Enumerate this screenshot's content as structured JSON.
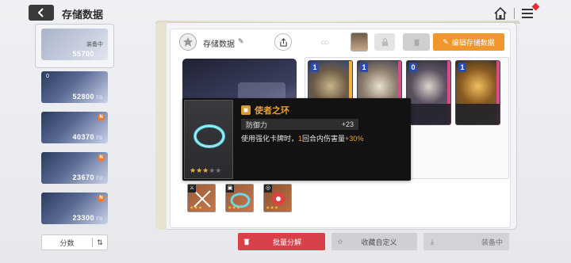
{
  "header": {
    "title": "存储数据"
  },
  "slots": [
    {
      "value": "55700",
      "unit": "TB",
      "status": "装备中",
      "badge": ""
    },
    {
      "value": "52800",
      "unit": "TB",
      "status": "",
      "badge": "",
      "index": "0"
    },
    {
      "value": "40370",
      "unit": "TB",
      "status": "",
      "badge": "N"
    },
    {
      "value": "23670",
      "unit": "TB",
      "status": "",
      "badge": "N"
    },
    {
      "value": "23300",
      "unit": "TB",
      "status": "",
      "badge": "N"
    }
  ],
  "sort": {
    "label": "分数"
  },
  "panel": {
    "title": "存储数据",
    "edit_button": "编辑存储数据"
  },
  "tooltip": {
    "name": "使者之环",
    "stat_label": "防御力",
    "stat_value": "+23",
    "desc_prefix": "使用强化卡牌时，",
    "desc_num": "1",
    "desc_mid": "回合内伤害量",
    "desc_pct": "+30%",
    "stars_on": 3,
    "stars_total": 5
  },
  "buttons": {
    "bulk": "批量分解",
    "favorite": "收藏自定义",
    "equipped": "装备中"
  },
  "colors": {
    "accent_orange": "#f0962a",
    "danger_red": "#d8404a",
    "tooltip_bg": "#121212"
  }
}
